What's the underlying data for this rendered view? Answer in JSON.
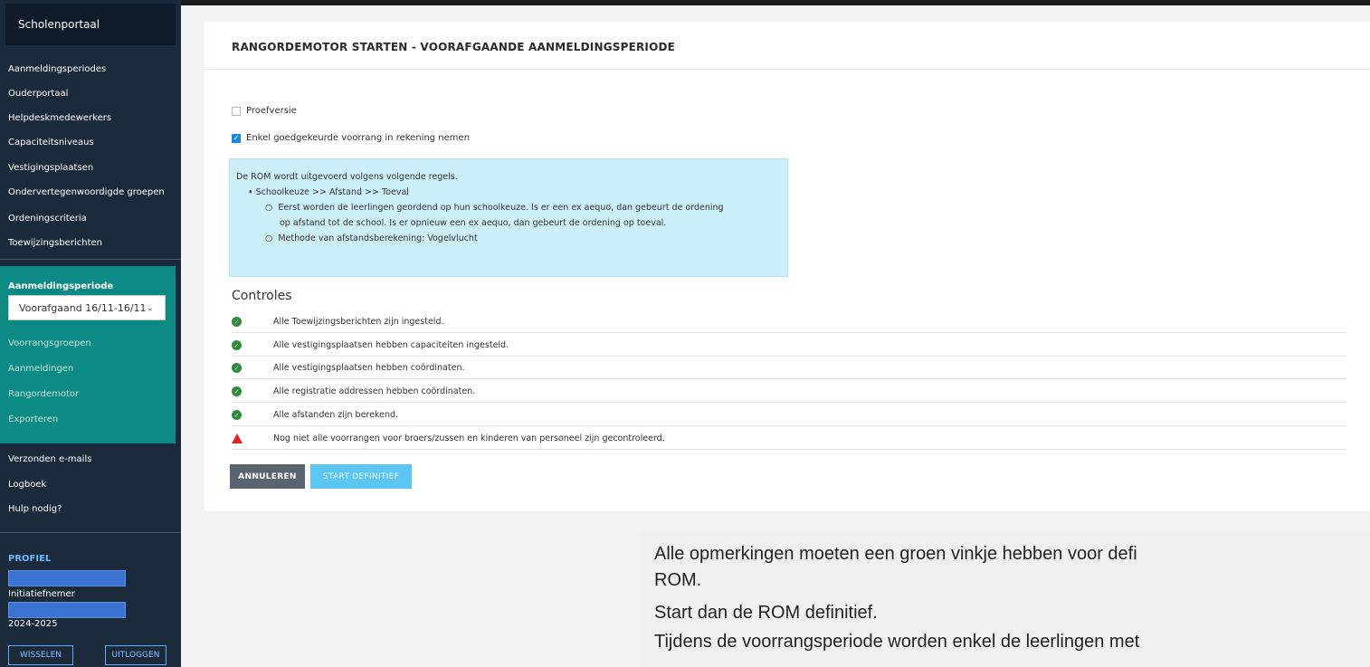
{
  "sidebar": {
    "portal_title": "Scholenportaal",
    "items": [
      {
        "label": "Aanmeldingsperiodes"
      },
      {
        "label": "Ouderportaal"
      },
      {
        "label": "Helpdeskmedewerkers"
      },
      {
        "label": "Capaciteitsniveaus"
      },
      {
        "label": "Vestigingsplaatsen"
      },
      {
        "label": "Ondervertegenwoordigde groepen"
      },
      {
        "label": "Ordeningscriteria"
      },
      {
        "label": "Toewijzingsberichten"
      }
    ],
    "period_section": {
      "title": "Aanmeldingsperiode",
      "selected": "Voorafgaand 16/11-16/11",
      "items": [
        {
          "label": "Voorrangsgroepen"
        },
        {
          "label": "Aanmeldingen"
        },
        {
          "label": "Rangordemotor"
        },
        {
          "label": "Exporteren"
        }
      ]
    },
    "bottom_items": [
      {
        "label": "Verzonden e-mails"
      },
      {
        "label": "Logboek"
      },
      {
        "label": "Hulp nodig?"
      }
    ],
    "profile": {
      "title": "PROFIEL",
      "role": "Initiatiefnemer",
      "year": "2024-2025",
      "switch_button": "WISSELEN",
      "logout_button": "UITLOGGEN"
    }
  },
  "main": {
    "title": "RANGORDEMOTOR STARTEN - VOORAFGAANDE AANMELDINGSPERIODE",
    "checkboxes": [
      {
        "label": "Proefversie",
        "checked": false
      },
      {
        "label": "Enkel goedgekeurde voorrang in rekening nemen",
        "checked": true
      }
    ],
    "info_box": {
      "intro": "De ROM wordt uitgevoerd volgens volgende regels.",
      "rule": "Schoolkeuze >> Afstand >> Toeval",
      "sub_line1": "Eerst worden de leerlingen geordend op hun schoolkeuze. Is er een ex aequo, dan gebeurt de ordening",
      "sub_line2": "op afstand tot de school. Is er opnieuw een ex aequo, dan gebeurt de ordening op toeval.",
      "method": "Methode van afstandsberekening: Vogelvlucht"
    },
    "controles_title": "Controles",
    "controls": [
      {
        "status": "ok",
        "text": "Alle Toewijzingsberichten zijn ingesteld."
      },
      {
        "status": "ok",
        "text": "Alle vestigingsplaatsen hebben capaciteiten ingesteld."
      },
      {
        "status": "ok",
        "text": "Alle vestigingsplaatsen hebben coördinaten."
      },
      {
        "status": "ok",
        "text": "Alle registratie addressen hebben coördinaten."
      },
      {
        "status": "ok",
        "text": "Alle afstanden zijn berekend."
      },
      {
        "status": "warning",
        "text": "Nog niet alle voorrangen voor broers/zussen en kinderen van personeel zijn gecontroleerd."
      }
    ],
    "cancel_button": "ANNULEREN",
    "start_button": "START DEFINITIEF"
  },
  "note": {
    "line1": "Alle opmerkingen moeten een groen vinkje hebben voor defi",
    "line2": "ROM.",
    "line3": "Start dan de ROM definitief.",
    "line4": "Tijdens de voorrangsperiode worden enkel de leerlingen met"
  },
  "colors": {
    "sidebar_bg": "#1b2a3a",
    "teal_section": "#0d8a84",
    "info_bg": "#cdf0f8",
    "ok_green": "#2e8b3e",
    "warning_red": "#e02424",
    "start_button": "#5cc6f2"
  }
}
